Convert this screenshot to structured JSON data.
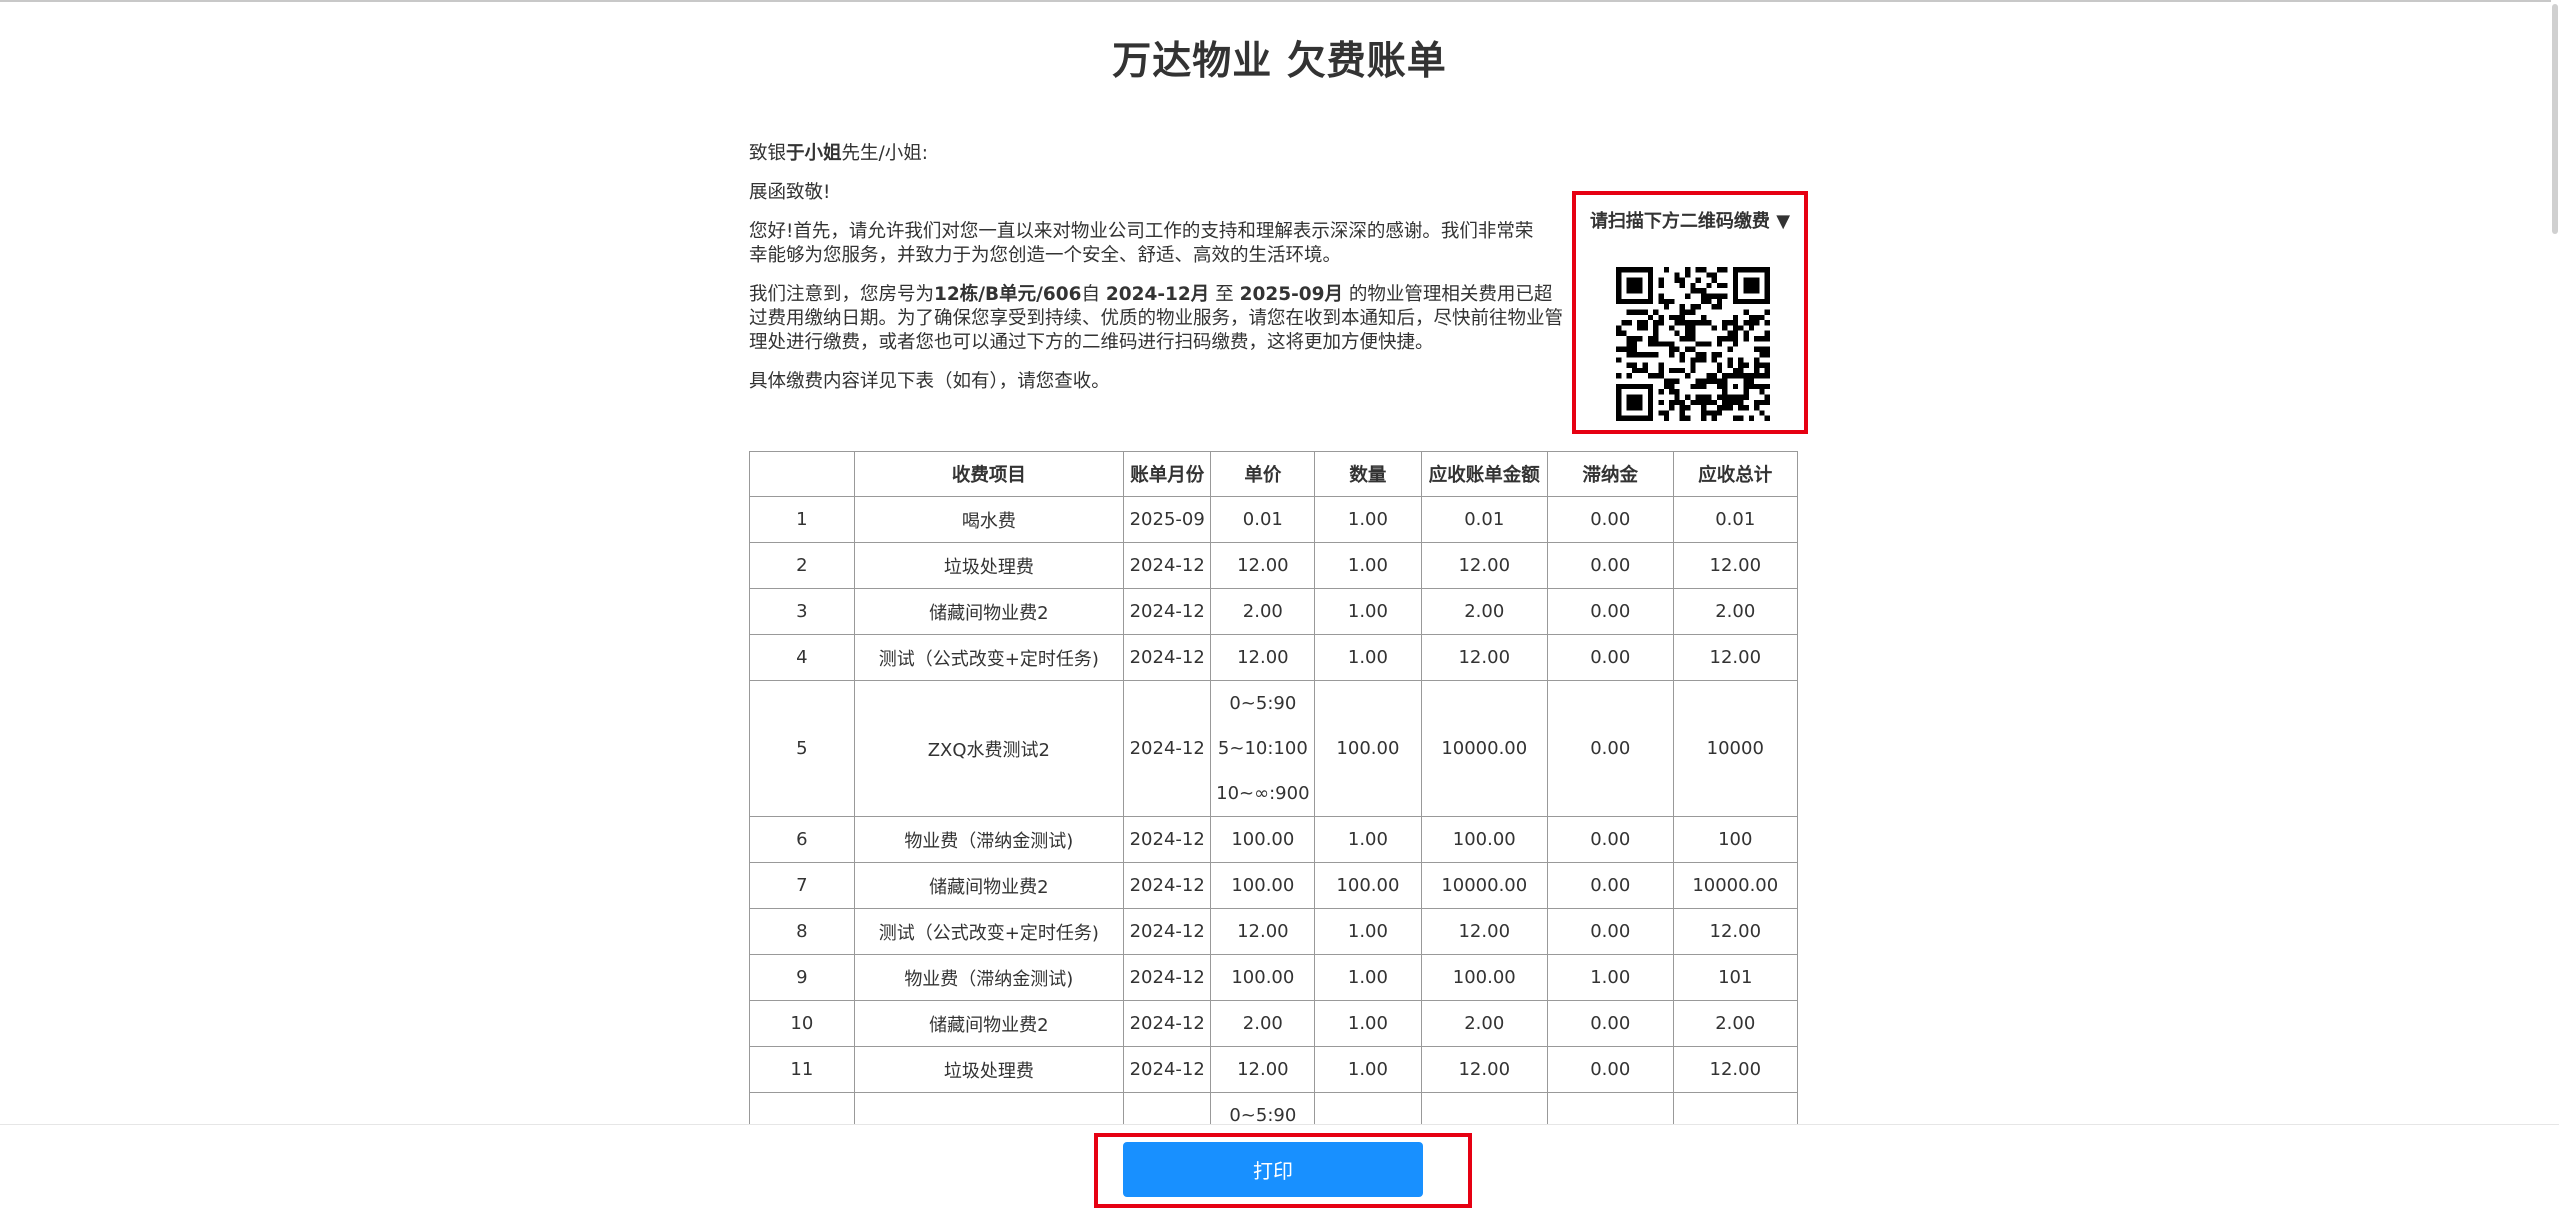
{
  "title": "万达物业 欠费账单",
  "letter": {
    "greeting_prefix": "致银",
    "greeting_name": "于小姐",
    "greeting_suffix": "先生/小姐:",
    "salutation": "展函致敬!",
    "para1": "您好!首先，请允许我们对您一直以来对物业公司工作的支持和理解表示深深的感谢。我们非常荣幸能够为您服务，并致力于为您创造一个安全、舒适、高效的生活环境。",
    "para2_a": "我们注意到，您房号为",
    "para2_room": "12栋/B单元/606",
    "para2_b": "自 ",
    "para2_from": "2024-12月",
    "para2_c": " 至 ",
    "para2_to": "2025-09月",
    "para2_d": " 的物业管理相关费用已超过费用缴纳日期。为了确保您享受到持续、优质的物业服务，请您在收到本通知后，尽快前往物业管理处进行缴费，或者您也可以通过下方的二维码进行扫码缴费，这将更加方便快捷。",
    "para3": "具体缴费内容详见下表（如有），请您查收。"
  },
  "qr": {
    "label": "请扫描下方二维码缴费 ▼",
    "icon": "qr-code-icon",
    "highlight_color": "#e60012"
  },
  "table": {
    "headers": [
      "",
      "收费项目",
      "账单月份",
      "单价",
      "数量",
      "应收账单金额",
      "滞纳金",
      "应收总计"
    ],
    "rows": [
      {
        "no": "1",
        "item": "喝水费",
        "month": "2025-09",
        "price": [
          "0.01"
        ],
        "qty": "1.00",
        "amount": "0.01",
        "late": "0.00",
        "total": "0.01"
      },
      {
        "no": "2",
        "item": "垃圾处理费",
        "month": "2024-12",
        "price": [
          "12.00"
        ],
        "qty": "1.00",
        "amount": "12.00",
        "late": "0.00",
        "total": "12.00"
      },
      {
        "no": "3",
        "item": "储藏间物业费2",
        "month": "2024-12",
        "price": [
          "2.00"
        ],
        "qty": "1.00",
        "amount": "2.00",
        "late": "0.00",
        "total": "2.00"
      },
      {
        "no": "4",
        "item": "测试（公式改变+定时任务)",
        "month": "2024-12",
        "price": [
          "12.00"
        ],
        "qty": "1.00",
        "amount": "12.00",
        "late": "0.00",
        "total": "12.00"
      },
      {
        "no": "5",
        "item": "ZXQ水费测试2",
        "month": "2024-12",
        "price": [
          "0~5:90",
          "5~10:100",
          "10~∞:900"
        ],
        "qty": "100.00",
        "amount": "10000.00",
        "late": "0.00",
        "total": "10000"
      },
      {
        "no": "6",
        "item": "物业费（滞纳金测试)",
        "month": "2024-12",
        "price": [
          "100.00"
        ],
        "qty": "1.00",
        "amount": "100.00",
        "late": "0.00",
        "total": "100"
      },
      {
        "no": "7",
        "item": "储藏间物业费2",
        "month": "2024-12",
        "price": [
          "100.00"
        ],
        "qty": "100.00",
        "amount": "10000.00",
        "late": "0.00",
        "total": "10000.00"
      },
      {
        "no": "8",
        "item": "测试（公式改变+定时任务)",
        "month": "2024-12",
        "price": [
          "12.00"
        ],
        "qty": "1.00",
        "amount": "12.00",
        "late": "0.00",
        "total": "12.00"
      },
      {
        "no": "9",
        "item": "物业费（滞纳金测试)",
        "month": "2024-12",
        "price": [
          "100.00"
        ],
        "qty": "1.00",
        "amount": "100.00",
        "late": "1.00",
        "total": "101"
      },
      {
        "no": "10",
        "item": "储藏间物业费2",
        "month": "2024-12",
        "price": [
          "2.00"
        ],
        "qty": "1.00",
        "amount": "2.00",
        "late": "0.00",
        "total": "2.00"
      },
      {
        "no": "11",
        "item": "垃圾处理费",
        "month": "2024-12",
        "price": [
          "12.00"
        ],
        "qty": "1.00",
        "amount": "12.00",
        "late": "0.00",
        "total": "12.00"
      },
      {
        "no": "",
        "item": "",
        "month": "",
        "price": [
          "0~5:90"
        ],
        "qty": "",
        "amount": "",
        "late": "",
        "total": ""
      }
    ]
  },
  "print_button": {
    "label": "打印",
    "color": "#1890ff",
    "highlight_color": "#e60012"
  }
}
